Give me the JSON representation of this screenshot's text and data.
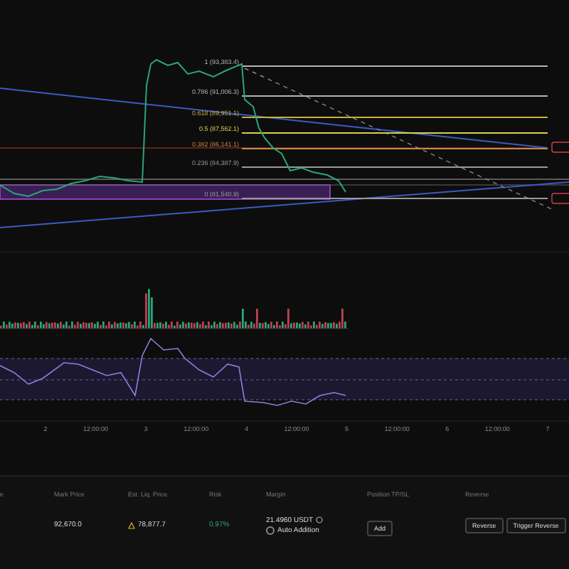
{
  "chart": {
    "fib_levels": [
      {
        "label": "1 (93,383.4)",
        "color": "#b5b5b5"
      },
      {
        "label": "0.786 (91,006.3)",
        "color": "#b5b5b5"
      },
      {
        "label": "0.618 (89,951.1)",
        "color": "#c9b23a"
      },
      {
        "label": "0.5 (87,562.1)",
        "color": "#d8d24a"
      },
      {
        "label": "0.382 (86,141.1)",
        "color": "#c98a3a"
      },
      {
        "label": "0.236 (84,387.9)",
        "color": "#9a9a9a"
      },
      {
        "label": "0 (81,540.9)",
        "color": "#9a9a9a"
      }
    ],
    "x_axis": [
      "2",
      "12:00:00",
      "3",
      "12:00:00",
      "4",
      "12:00:00",
      "5",
      "12:00:00",
      "6",
      "12:00:00",
      "7"
    ]
  },
  "positions": {
    "columns": [
      "e",
      "Mark Price",
      "Est. Liq. Price",
      "Risk",
      "Margin",
      "Position TP/SL",
      "Reverse"
    ],
    "mark_price": "92,670.0",
    "liq_price": "78,877.7",
    "risk": "0.97%",
    "margin": "21.4960 USDT",
    "auto_addition": {
      "label": "Auto Addition",
      "checked": false
    },
    "tpsl_button": "Add",
    "reverse_buttons": [
      "Reverse",
      "Trigger Reverse"
    ]
  }
}
